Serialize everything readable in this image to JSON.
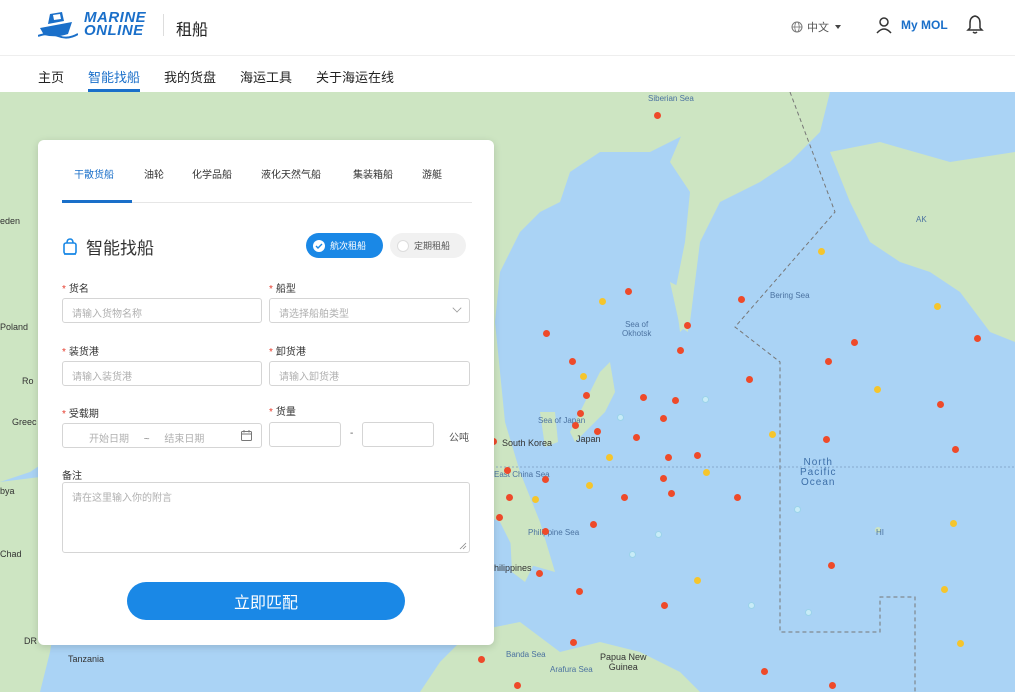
{
  "header": {
    "logo_line1": "MARINE",
    "logo_line2": "ONLINE",
    "sub_title": "租船",
    "language": "中文",
    "account_label": "My MOL"
  },
  "nav": {
    "items": [
      "主页",
      "智能找船",
      "我的货盘",
      "海运工具",
      "关于海运在线"
    ],
    "active_index": 1
  },
  "map": {
    "labels": {
      "siberian_sea": "Siberian Sea",
      "bering_sea": "Bering Sea",
      "sea_of_okhotsk_1": "Sea of",
      "sea_of_okhotsk_2": "Okhotsk",
      "sea_of_japan": "Sea of Japan",
      "south_korea": "South Korea",
      "japan": "Japan",
      "east_china_sea": "East China Sea",
      "philippine_sea": "Philippine Sea",
      "philippines": "Philippines",
      "north_pacific_1": "North",
      "north_pacific_2": "Pacific",
      "north_pacific_3": "Ocean",
      "banda_sea": "Banda Sea",
      "arafura_sea": "Arafura Sea",
      "papua_1": "Papua New",
      "papua_2": "Guinea",
      "tanzania": "Tanzania",
      "poland": "Poland",
      "libya": "bya",
      "chad": "Chad",
      "greece": "Greec",
      "sweden": "eden",
      "romania": "Ro",
      "drc": "DR",
      "ak": "AK",
      "hi": "HI"
    },
    "colors": {
      "ocean": "#aad3f5",
      "land": "#cde5c2",
      "red_dot": "#ee4a2a",
      "yellow_dot": "#f5c52d",
      "blue_dot": "#c8ecf7"
    }
  },
  "panel": {
    "tabs": [
      "干散货船",
      "油轮",
      "化学品船",
      "液化天然气船",
      "集装箱船",
      "游艇"
    ],
    "active_tab": 0,
    "title": "智能找船",
    "toggle_voyage": "航次租船",
    "toggle_time": "定期租船",
    "cargo_name_label": "货名",
    "cargo_name_placeholder": "请输入货物名称",
    "ship_type_label": "船型",
    "ship_type_placeholder": "请选择船舶类型",
    "load_port_label": "装货港",
    "load_port_placeholder": "请输入装货港",
    "discharge_port_label": "卸货港",
    "discharge_port_placeholder": "请输入卸货港",
    "laycan_label": "受载期",
    "start_date_placeholder": "开始日期",
    "date_separator": "~",
    "end_date_placeholder": "结束日期",
    "quantity_label": "货量",
    "quantity_dash": "-",
    "quantity_unit": "公吨",
    "remarks_label": "备注",
    "remarks_placeholder": "请在这里输入你的附言",
    "submit_label": "立即匹配"
  }
}
